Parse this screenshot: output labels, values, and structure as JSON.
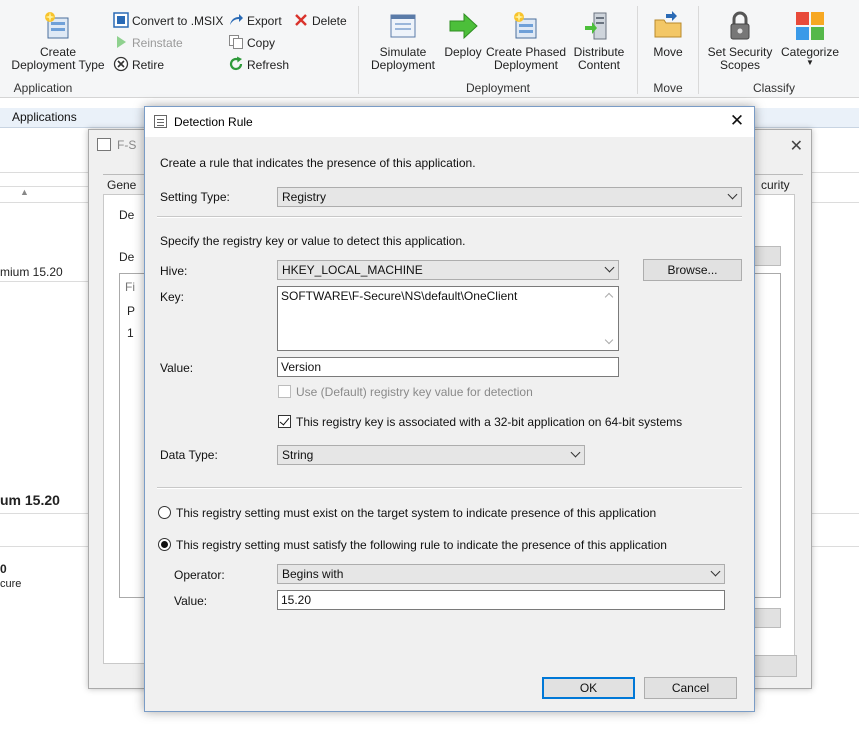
{
  "ribbon": {
    "create_deployment_type": "Create\nDeployment Type",
    "convert_msix": "Convert to .MSIX",
    "reinstate": "Reinstate",
    "retire": "Retire",
    "export": "Export",
    "copy": "Copy",
    "refresh": "Refresh",
    "delete": "Delete",
    "group_application": "Application",
    "simulate_deployment": "Simulate\nDeployment",
    "deploy": "Deploy",
    "create_phased_deployment": "Create Phased\nDeployment",
    "distribute_content": "Distribute\nContent",
    "group_deployment": "Deployment",
    "move": "Move",
    "group_move": "Move",
    "set_security_scopes": "Set Security\nScopes",
    "categorize": "Categorize",
    "group_classify": "Classify"
  },
  "nav": {
    "applications_tab": "Applications"
  },
  "background": {
    "row1": "mium 15.20",
    "heading": "um 15.20",
    "item_zero": "0",
    "item_cure": "cure",
    "mid_dialog_title": "F-S",
    "mid_tab_general": "Gene",
    "mid_tab_security": "curity",
    "mid_de1": "De",
    "mid_de2": "De",
    "mid_fi": "Fi",
    "mid_p": "P",
    "mid_1": "1"
  },
  "dialog": {
    "title": "Detection Rule",
    "intro": "Create a rule that indicates the presence of this application.",
    "setting_type_label": "Setting Type:",
    "setting_type_value": "Registry",
    "specify_text": "Specify the registry key or value to detect this application.",
    "hive_label": "Hive:",
    "hive_value": "HKEY_LOCAL_MACHINE",
    "browse_label": "Browse...",
    "key_label": "Key:",
    "key_value": "SOFTWARE\\F-Secure\\NS\\default\\OneClient",
    "value_label": "Value:",
    "value_value": "Version",
    "use_default_label": "Use (Default) registry key value for detection",
    "use_default_checked": false,
    "is32bit_label": "This registry key is associated with a 32-bit application on 64-bit systems",
    "is32bit_checked": true,
    "data_type_label": "Data Type:",
    "data_type_value": "String",
    "radio_exist_label": "This registry setting must exist on the target system to indicate presence of this application",
    "radio_exist_selected": false,
    "radio_rule_label": "This registry setting must satisfy the following rule to indicate the presence of this application",
    "radio_rule_selected": true,
    "operator_label": "Operator:",
    "operator_value": "Begins with",
    "rule_value_label": "Value:",
    "rule_value_value": "15.20",
    "ok_label": "OK",
    "cancel_label": "Cancel"
  },
  "colors": {
    "accent": "#0078d7",
    "dialog_bg": "#f0f0f0",
    "ribbon_bg": "#f5f6f7"
  }
}
